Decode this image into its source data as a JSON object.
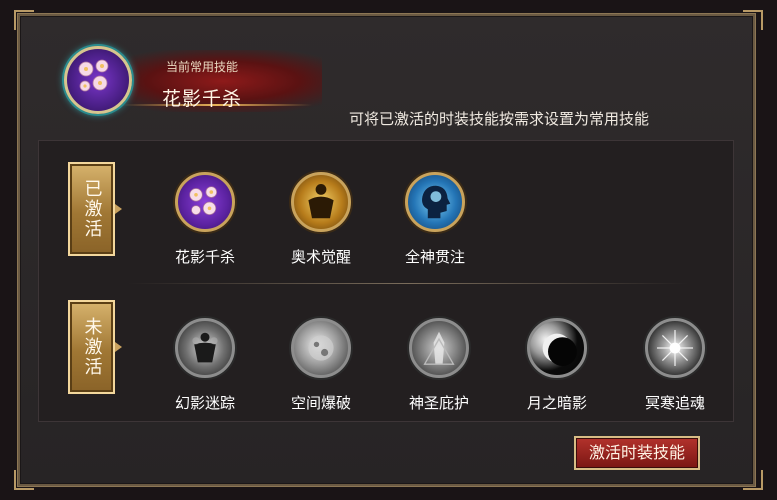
{
  "header": {
    "current_label": "当前常用技能",
    "current_name": "花影千杀",
    "hint": "可将已激活的时装技能按需求设置为常用技能"
  },
  "tags": {
    "active": "已激活",
    "inactive": "未激活"
  },
  "skills": {
    "active": [
      {
        "name": "花影千杀",
        "icon": "cherry-blossom-icon"
      },
      {
        "name": "奥术觉醒",
        "icon": "golden-body-icon"
      },
      {
        "name": "全神贯注",
        "icon": "focus-head-icon"
      }
    ],
    "inactive": [
      {
        "name": "幻影迷踪",
        "icon": "phantom-icon"
      },
      {
        "name": "空间爆破",
        "icon": "space-blast-icon"
      },
      {
        "name": "神圣庇护",
        "icon": "holy-guard-icon"
      },
      {
        "name": "月之暗影",
        "icon": "moon-shadow-icon"
      },
      {
        "name": "冥寒追魂",
        "icon": "frost-soul-icon"
      }
    ]
  },
  "buttons": {
    "activate": "激活时装技能"
  },
  "colors": {
    "accent_gold": "#c9a35c",
    "button_red": "#b3322c",
    "panel_bg": "#2f2b2c"
  }
}
